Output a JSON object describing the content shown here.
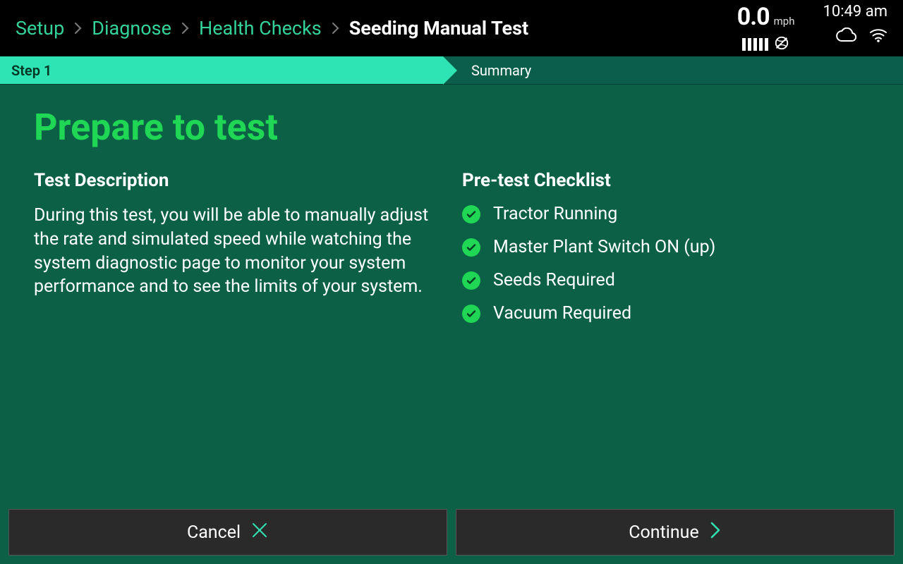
{
  "breadcrumb": {
    "items": [
      {
        "label": "Setup"
      },
      {
        "label": "Diagnose"
      },
      {
        "label": "Health Checks"
      },
      {
        "label": "Seeding Manual Test"
      }
    ]
  },
  "status": {
    "speed_value": "0.0",
    "speed_unit": "mph",
    "time": "10:49 am"
  },
  "steps": {
    "step1": "Step 1",
    "summary": "Summary"
  },
  "page": {
    "title": "Prepare to test",
    "desc_heading": "Test Description",
    "desc_body": "During this test, you will be able to manually adjust the rate and simulated speed while watching the system diagnostic page to monitor your system performance and to see the limits of your system.",
    "checklist_heading": "Pre-test Checklist",
    "checklist": [
      "Tractor Running",
      "Master Plant Switch ON (up)",
      "Seeds Required",
      "Vacuum Required"
    ]
  },
  "footer": {
    "cancel": "Cancel",
    "continue": "Continue"
  }
}
